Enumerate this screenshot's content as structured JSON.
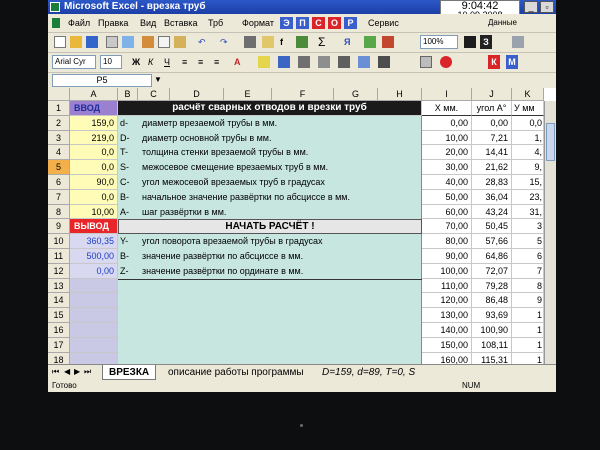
{
  "window": {
    "title": "Microsoft Excel - врезка труб",
    "clock_time": "9:04:42",
    "clock_date": "10.09.2008"
  },
  "menu": {
    "items": [
      "Файл",
      "Правка",
      "Вид",
      "Вставка",
      "Трб",
      "Формат",
      "Сервис"
    ],
    "square_letters": [
      "Э",
      "П",
      "С",
      "О",
      "Р"
    ],
    "right_label": "Данные"
  },
  "toolbar": {
    "zoom": "100%",
    "font_name": "Arial Cyr",
    "font_size": "10",
    "bold_label": "Ж",
    "italic_label": "К",
    "underline_label": "Ч",
    "sigma_label": "Σ",
    "fx_label": "f",
    "sort_label": "Я",
    "right_letters": [
      "В",
      "З",
      "К",
      "М"
    ]
  },
  "formula_bar": {
    "cell_ref": "P5"
  },
  "columns": [
    "A",
    "B",
    "C",
    "D",
    "E",
    "F",
    "G",
    "H",
    "I",
    "J",
    "K"
  ],
  "rows": [
    "1",
    "2",
    "3",
    "4",
    "5",
    "6",
    "7",
    "8",
    "9",
    "10",
    "11",
    "12",
    "13",
    "14",
    "15",
    "16",
    "17",
    "18"
  ],
  "col_a": {
    "input_label": "ВВОД",
    "inputs": [
      "159,0",
      "219,0",
      "0,0",
      "0,0",
      "90,0",
      "0,0",
      "10,00"
    ],
    "output_label": "ВЫВОД",
    "outputs": [
      "360,35",
      "500,00",
      "0,00"
    ]
  },
  "header_title": "расчёт сварных отводов и врезки труб",
  "params": [
    {
      "sym": "d-",
      "text": "диаметр врезаемой трубы в мм."
    },
    {
      "sym": "D-",
      "text": "диаметр основной трубы в мм."
    },
    {
      "sym": "T-",
      "text": "толщина стенки врезаемой трубы в мм."
    },
    {
      "sym": "S-",
      "text": "межосевое смещение врезаемых труб в мм."
    },
    {
      "sym": "C-",
      "text": "угол межосевой врезаемых труб в градусах"
    },
    {
      "sym": "B-",
      "text": "начальное значение развёртки по абсциссе в мм."
    },
    {
      "sym": "A-",
      "text": "шаг развёртки в мм."
    }
  ],
  "calc_button": "НАЧАТЬ РАСЧЁТ !",
  "results": [
    {
      "sym": "Y-",
      "text": "угол поворота врезаемой трубы в градусах"
    },
    {
      "sym": "B-",
      "text": "значение развёртки по абсциссе в мм."
    },
    {
      "sym": "Z-",
      "text": "значение развёртки по ординате в мм."
    }
  ],
  "table": {
    "header_x": "Х мм.",
    "header_angle": "угол А°",
    "header_y": "У мм",
    "x": [
      "0,00",
      "10,00",
      "20,00",
      "30,00",
      "40,00",
      "50,00",
      "60,00",
      "70,00",
      "80,00",
      "90,00",
      "100,00",
      "110,00",
      "120,00",
      "130,00",
      "140,00",
      "150,00",
      "160,00"
    ],
    "angle": [
      "0,00",
      "7,21",
      "14,41",
      "21,62",
      "28,83",
      "36,04",
      "43,24",
      "50,45",
      "57,66",
      "64,86",
      "72,07",
      "79,28",
      "86,48",
      "93,69",
      "100,90",
      "108,11",
      "115,31"
    ],
    "y": [
      "0,0",
      "1,",
      "4,",
      "9,",
      "15,",
      "23,",
      "31,",
      "3",
      "5",
      "6",
      "7",
      "8",
      "9",
      "1",
      "1",
      "1",
      "1"
    ]
  },
  "sheet_tabs": {
    "active": "ВРЕЗКА",
    "second": "описание работы программы",
    "third": "D=159, d=89, T=0, S"
  },
  "status": {
    "left": "Готово",
    "num": "NUM"
  }
}
